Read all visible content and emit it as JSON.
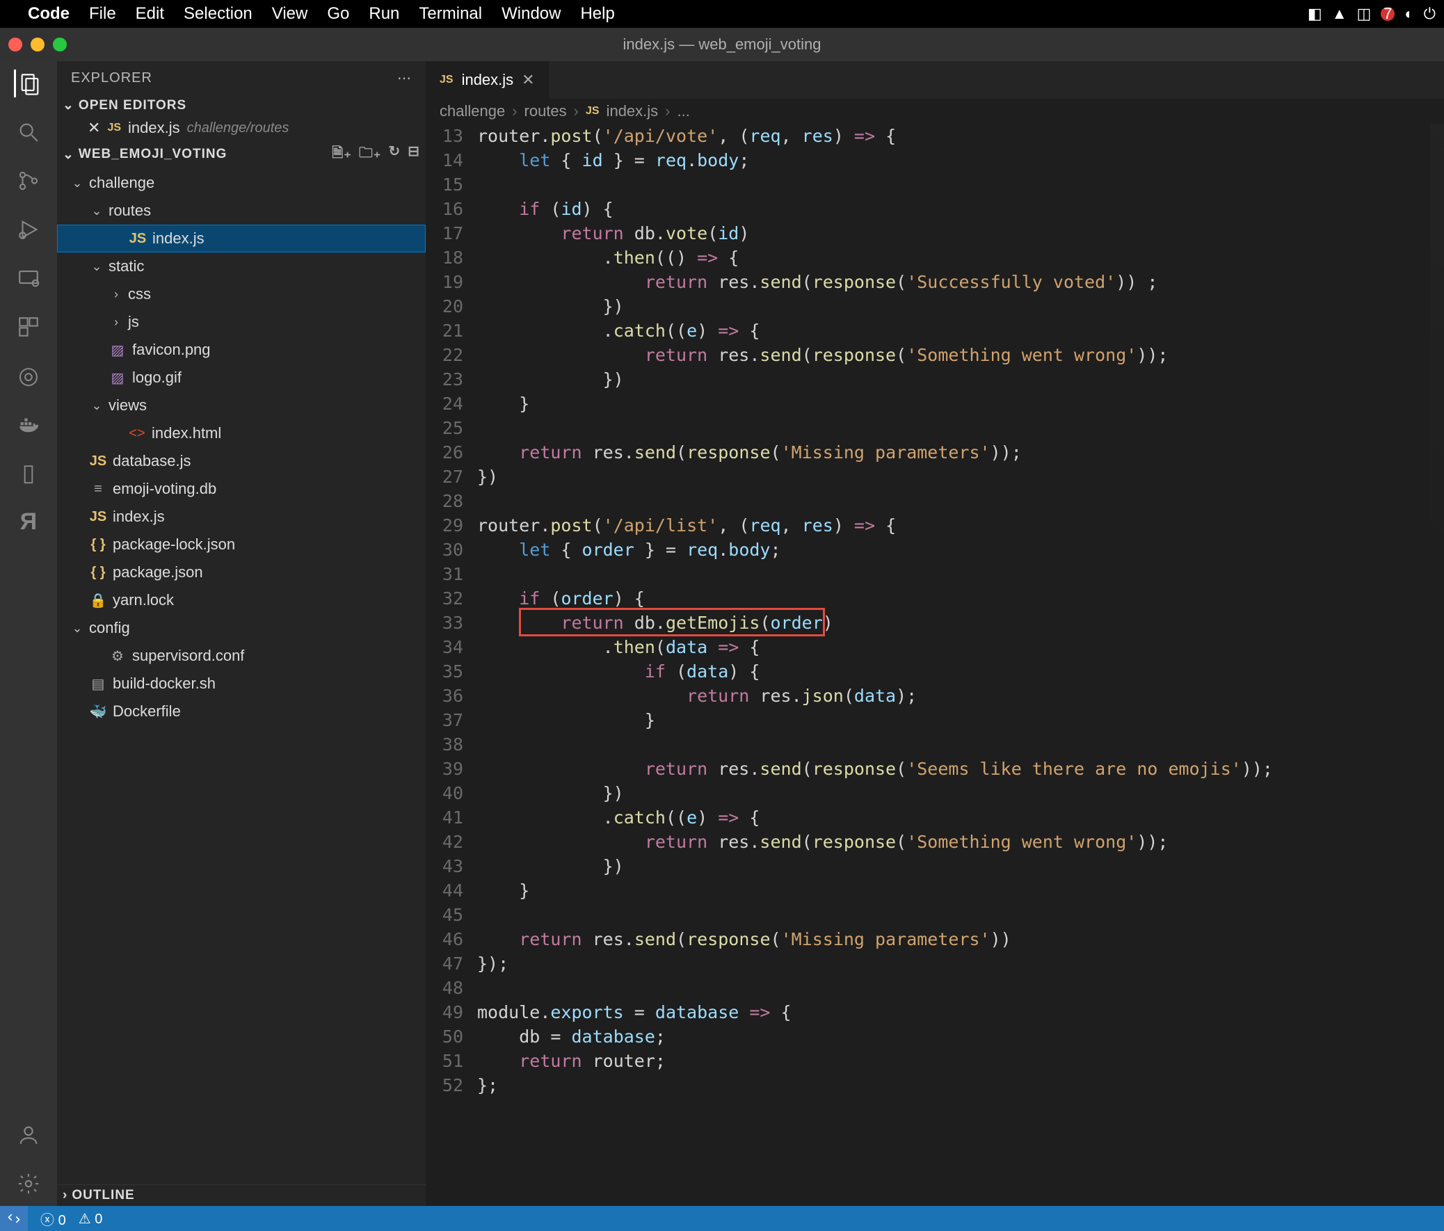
{
  "menubar": {
    "app": "Code",
    "items": [
      "File",
      "Edit",
      "Selection",
      "View",
      "Go",
      "Run",
      "Terminal",
      "Window",
      "Help"
    ],
    "badge": "7"
  },
  "titlebar": {
    "title": "index.js — web_emoji_voting"
  },
  "sidebar": {
    "title": "EXPLORER",
    "open_editors": "OPEN EDITORS",
    "open_file": "index.js",
    "open_path": "challenge/routes",
    "project": "WEB_EMOJI_VOTING",
    "outline": "OUTLINE",
    "tree": [
      {
        "d": 0,
        "t": "folder",
        "open": true,
        "name": "challenge"
      },
      {
        "d": 1,
        "t": "folder",
        "open": true,
        "name": "routes"
      },
      {
        "d": 2,
        "t": "js",
        "name": "index.js",
        "selected": true
      },
      {
        "d": 1,
        "t": "folder",
        "open": true,
        "name": "static"
      },
      {
        "d": 2,
        "t": "folder",
        "open": false,
        "name": "css"
      },
      {
        "d": 2,
        "t": "folder",
        "open": false,
        "name": "js"
      },
      {
        "d": 1,
        "t": "img",
        "name": "favicon.png"
      },
      {
        "d": 1,
        "t": "img",
        "name": "logo.gif"
      },
      {
        "d": 1,
        "t": "folder",
        "open": true,
        "name": "views"
      },
      {
        "d": 2,
        "t": "html",
        "name": "index.html"
      },
      {
        "d": 0,
        "t": "js",
        "name": "database.js"
      },
      {
        "d": 0,
        "t": "db",
        "name": "emoji-voting.db"
      },
      {
        "d": 0,
        "t": "js",
        "name": "index.js"
      },
      {
        "d": 0,
        "t": "json",
        "name": "package-lock.json"
      },
      {
        "d": 0,
        "t": "json",
        "name": "package.json"
      },
      {
        "d": 0,
        "t": "lock",
        "name": "yarn.lock"
      },
      {
        "d": 0,
        "t": "folder",
        "open": true,
        "name": "config"
      },
      {
        "d": 1,
        "t": "gear",
        "name": "supervisord.conf"
      },
      {
        "d": 0,
        "t": "sh",
        "name": "build-docker.sh"
      },
      {
        "d": 0,
        "t": "docker",
        "name": "Dockerfile"
      }
    ]
  },
  "tab": {
    "name": "index.js"
  },
  "breadcrumb": [
    "challenge",
    "routes",
    "index.js",
    "..."
  ],
  "code": {
    "start": 13,
    "lines": [
      [
        [
          0,
          "ident",
          "router"
        ],
        [
          0,
          "pun",
          "."
        ],
        [
          0,
          "fn",
          "post"
        ],
        [
          0,
          "pun",
          "("
        ],
        [
          0,
          "str",
          "'/api/vote'"
        ],
        [
          0,
          "pun",
          ", ("
        ],
        [
          0,
          "var",
          "req"
        ],
        [
          0,
          "pun",
          ", "
        ],
        [
          0,
          "var",
          "res"
        ],
        [
          0,
          "pun",
          ") "
        ],
        [
          0,
          "kw",
          "=>"
        ],
        [
          0,
          "pun",
          " {"
        ]
      ],
      [
        [
          1,
          "const",
          "let"
        ],
        [
          0,
          "pun",
          " { "
        ],
        [
          0,
          "var",
          "id"
        ],
        [
          0,
          "pun",
          " } = "
        ],
        [
          0,
          "var",
          "req"
        ],
        [
          0,
          "pun",
          "."
        ],
        [
          0,
          "var",
          "body"
        ],
        [
          0,
          "pun",
          ";"
        ]
      ],
      [],
      [
        [
          1,
          "kw",
          "if"
        ],
        [
          0,
          "pun",
          " ("
        ],
        [
          0,
          "var",
          "id"
        ],
        [
          0,
          "pun",
          ") {"
        ]
      ],
      [
        [
          2,
          "kw",
          "return"
        ],
        [
          0,
          "pun",
          " "
        ],
        [
          0,
          "ident",
          "db"
        ],
        [
          0,
          "pun",
          "."
        ],
        [
          0,
          "fn",
          "vote"
        ],
        [
          0,
          "pun",
          "("
        ],
        [
          0,
          "var",
          "id"
        ],
        [
          0,
          "pun",
          ")"
        ]
      ],
      [
        [
          3,
          "pun",
          "."
        ],
        [
          0,
          "fn",
          "then"
        ],
        [
          0,
          "pun",
          "(() "
        ],
        [
          0,
          "kw",
          "=>"
        ],
        [
          0,
          "pun",
          " {"
        ]
      ],
      [
        [
          4,
          "kw",
          "return"
        ],
        [
          0,
          "pun",
          " "
        ],
        [
          0,
          "ident",
          "res"
        ],
        [
          0,
          "pun",
          "."
        ],
        [
          0,
          "fn",
          "send"
        ],
        [
          0,
          "pun",
          "("
        ],
        [
          0,
          "fn",
          "response"
        ],
        [
          0,
          "pun",
          "("
        ],
        [
          0,
          "str",
          "'Successfully voted'"
        ],
        [
          0,
          "pun",
          ")) ;"
        ]
      ],
      [
        [
          3,
          "pun",
          "})"
        ]
      ],
      [
        [
          3,
          "pun",
          "."
        ],
        [
          0,
          "fn",
          "catch"
        ],
        [
          0,
          "pun",
          "(("
        ],
        [
          0,
          "var",
          "e"
        ],
        [
          0,
          "pun",
          ") "
        ],
        [
          0,
          "kw",
          "=>"
        ],
        [
          0,
          "pun",
          " {"
        ]
      ],
      [
        [
          4,
          "kw",
          "return"
        ],
        [
          0,
          "pun",
          " "
        ],
        [
          0,
          "ident",
          "res"
        ],
        [
          0,
          "pun",
          "."
        ],
        [
          0,
          "fn",
          "send"
        ],
        [
          0,
          "pun",
          "("
        ],
        [
          0,
          "fn",
          "response"
        ],
        [
          0,
          "pun",
          "("
        ],
        [
          0,
          "str",
          "'Something went wrong'"
        ],
        [
          0,
          "pun",
          "));"
        ]
      ],
      [
        [
          3,
          "pun",
          "})"
        ]
      ],
      [
        [
          1,
          "pun",
          "}"
        ]
      ],
      [],
      [
        [
          1,
          "kw",
          "return"
        ],
        [
          0,
          "pun",
          " "
        ],
        [
          0,
          "ident",
          "res"
        ],
        [
          0,
          "pun",
          "."
        ],
        [
          0,
          "fn",
          "send"
        ],
        [
          0,
          "pun",
          "("
        ],
        [
          0,
          "fn",
          "response"
        ],
        [
          0,
          "pun",
          "("
        ],
        [
          0,
          "str",
          "'Missing parameters'"
        ],
        [
          0,
          "pun",
          "));"
        ]
      ],
      [
        [
          0,
          "pun",
          "})"
        ]
      ],
      [],
      [
        [
          0,
          "ident",
          "router"
        ],
        [
          0,
          "pun",
          "."
        ],
        [
          0,
          "fn",
          "post"
        ],
        [
          0,
          "pun",
          "("
        ],
        [
          0,
          "str",
          "'/api/list'"
        ],
        [
          0,
          "pun",
          ", ("
        ],
        [
          0,
          "var",
          "req"
        ],
        [
          0,
          "pun",
          ", "
        ],
        [
          0,
          "var",
          "res"
        ],
        [
          0,
          "pun",
          ") "
        ],
        [
          0,
          "kw",
          "=>"
        ],
        [
          0,
          "pun",
          " {"
        ]
      ],
      [
        [
          1,
          "const",
          "let"
        ],
        [
          0,
          "pun",
          " { "
        ],
        [
          0,
          "var",
          "order"
        ],
        [
          0,
          "pun",
          " } = "
        ],
        [
          0,
          "var",
          "req"
        ],
        [
          0,
          "pun",
          "."
        ],
        [
          0,
          "var",
          "body"
        ],
        [
          0,
          "pun",
          ";"
        ]
      ],
      [],
      [
        [
          1,
          "kw",
          "if"
        ],
        [
          0,
          "pun",
          " ("
        ],
        [
          0,
          "var",
          "order"
        ],
        [
          0,
          "pun",
          ") {"
        ]
      ],
      [
        [
          2,
          "kw",
          "return"
        ],
        [
          0,
          "pun",
          " "
        ],
        [
          0,
          "ident",
          "db"
        ],
        [
          0,
          "pun",
          "."
        ],
        [
          0,
          "fn",
          "getEmojis"
        ],
        [
          0,
          "pun",
          "("
        ],
        [
          0,
          "var",
          "order"
        ],
        [
          0,
          "pun",
          ")"
        ]
      ],
      [
        [
          3,
          "pun",
          "."
        ],
        [
          0,
          "fn",
          "then"
        ],
        [
          0,
          "pun",
          "("
        ],
        [
          0,
          "var",
          "data"
        ],
        [
          0,
          "pun",
          " "
        ],
        [
          0,
          "kw",
          "=>"
        ],
        [
          0,
          "pun",
          " {"
        ]
      ],
      [
        [
          4,
          "kw",
          "if"
        ],
        [
          0,
          "pun",
          " ("
        ],
        [
          0,
          "var",
          "data"
        ],
        [
          0,
          "pun",
          ") {"
        ]
      ],
      [
        [
          5,
          "kw",
          "return"
        ],
        [
          0,
          "pun",
          " "
        ],
        [
          0,
          "ident",
          "res"
        ],
        [
          0,
          "pun",
          "."
        ],
        [
          0,
          "fn",
          "json"
        ],
        [
          0,
          "pun",
          "("
        ],
        [
          0,
          "var",
          "data"
        ],
        [
          0,
          "pun",
          ");"
        ]
      ],
      [
        [
          4,
          "pun",
          "}"
        ]
      ],
      [],
      [
        [
          4,
          "kw",
          "return"
        ],
        [
          0,
          "pun",
          " "
        ],
        [
          0,
          "ident",
          "res"
        ],
        [
          0,
          "pun",
          "."
        ],
        [
          0,
          "fn",
          "send"
        ],
        [
          0,
          "pun",
          "("
        ],
        [
          0,
          "fn",
          "response"
        ],
        [
          0,
          "pun",
          "("
        ],
        [
          0,
          "str",
          "'Seems like there are no emojis'"
        ],
        [
          0,
          "pun",
          "));"
        ]
      ],
      [
        [
          3,
          "pun",
          "})"
        ]
      ],
      [
        [
          3,
          "pun",
          "."
        ],
        [
          0,
          "fn",
          "catch"
        ],
        [
          0,
          "pun",
          "(("
        ],
        [
          0,
          "var",
          "e"
        ],
        [
          0,
          "pun",
          ") "
        ],
        [
          0,
          "kw",
          "=>"
        ],
        [
          0,
          "pun",
          " {"
        ]
      ],
      [
        [
          4,
          "kw",
          "return"
        ],
        [
          0,
          "pun",
          " "
        ],
        [
          0,
          "ident",
          "res"
        ],
        [
          0,
          "pun",
          "."
        ],
        [
          0,
          "fn",
          "send"
        ],
        [
          0,
          "pun",
          "("
        ],
        [
          0,
          "fn",
          "response"
        ],
        [
          0,
          "pun",
          "("
        ],
        [
          0,
          "str",
          "'Something went wrong'"
        ],
        [
          0,
          "pun",
          "));"
        ]
      ],
      [
        [
          3,
          "pun",
          "})"
        ]
      ],
      [
        [
          1,
          "pun",
          "}"
        ]
      ],
      [],
      [
        [
          1,
          "kw",
          "return"
        ],
        [
          0,
          "pun",
          " "
        ],
        [
          0,
          "ident",
          "res"
        ],
        [
          0,
          "pun",
          "."
        ],
        [
          0,
          "fn",
          "send"
        ],
        [
          0,
          "pun",
          "("
        ],
        [
          0,
          "fn",
          "response"
        ],
        [
          0,
          "pun",
          "("
        ],
        [
          0,
          "str",
          "'Missing parameters'"
        ],
        [
          0,
          "pun",
          "))"
        ]
      ],
      [
        [
          0,
          "pun",
          "});"
        ]
      ],
      [],
      [
        [
          0,
          "ident",
          "module"
        ],
        [
          0,
          "pun",
          "."
        ],
        [
          0,
          "var",
          "exports"
        ],
        [
          0,
          "pun",
          " = "
        ],
        [
          0,
          "var",
          "database"
        ],
        [
          0,
          "pun",
          " "
        ],
        [
          0,
          "kw",
          "=>"
        ],
        [
          0,
          "pun",
          " {"
        ]
      ],
      [
        [
          1,
          "ident",
          "db"
        ],
        [
          0,
          "pun",
          " = "
        ],
        [
          0,
          "var",
          "database"
        ],
        [
          0,
          "pun",
          ";"
        ]
      ],
      [
        [
          1,
          "kw",
          "return"
        ],
        [
          0,
          "pun",
          " "
        ],
        [
          0,
          "ident",
          "router"
        ],
        [
          0,
          "pun",
          ";"
        ]
      ],
      [
        [
          0,
          "pun",
          "};"
        ]
      ]
    ],
    "highlight_line": 33
  },
  "status": {
    "errors": "0",
    "warnings": "0"
  }
}
